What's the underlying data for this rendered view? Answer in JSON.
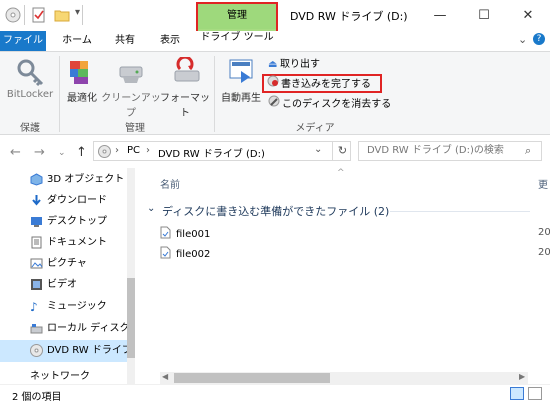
{
  "window": {
    "title": "DVD RW ドライブ (D:)",
    "minimize": "—",
    "maximize": "☐",
    "close": "✕"
  },
  "ribbon_tabs": {
    "file": "ファイル",
    "home": "ホーム",
    "share": "共有",
    "view": "表示",
    "context_group": "管理",
    "drive_tools": "ドライブ ツール",
    "expand": "⌄",
    "help": "?"
  },
  "ribbon": {
    "protect": {
      "bitlocker": "BitLocker",
      "group": "保護"
    },
    "manage": {
      "optimize": "最適化",
      "cleanup": "クリーンアップ",
      "format": "フォーマット",
      "group": "管理"
    },
    "media": {
      "autoplay": "自動再生",
      "eject": "取り出す",
      "finish_burning": "書き込みを完了する",
      "erase": "このディスクを消去する",
      "group": "メディア"
    }
  },
  "address": {
    "path_pc": "PC",
    "path_drive": "DVD RW ドライブ (D:)",
    "search_placeholder": "DVD RW ドライブ (D:)の検索"
  },
  "nav": {
    "items": [
      {
        "label": "3D オブジェクト",
        "icon": "3d-objects-icon"
      },
      {
        "label": "ダウンロード",
        "icon": "download-icon"
      },
      {
        "label": "デスクトップ",
        "icon": "desktop-icon"
      },
      {
        "label": "ドキュメント",
        "icon": "documents-icon"
      },
      {
        "label": "ピクチャ",
        "icon": "pictures-icon"
      },
      {
        "label": "ビデオ",
        "icon": "video-icon"
      },
      {
        "label": "ミュージック",
        "icon": "music-icon"
      },
      {
        "label": "ローカル ディスク (C",
        "icon": "local-disk-icon"
      },
      {
        "label": "DVD RW ドライブ (",
        "icon": "dvd-drive-icon"
      },
      {
        "label": "ネットワーク",
        "icon": "network-icon"
      }
    ]
  },
  "content": {
    "col_name": "名前",
    "col_date": "更",
    "group_header": "ディスクに書き込む準備ができたファイル (2)",
    "files": [
      {
        "name": "file001",
        "date": "20"
      },
      {
        "name": "file002",
        "date": "20"
      }
    ]
  },
  "status": {
    "count": "2 個の項目"
  },
  "colors": {
    "file_tab": "#1979ca",
    "context_green": "#9ed97c",
    "highlight_red": "#e02424",
    "selection": "#cce8ff"
  }
}
